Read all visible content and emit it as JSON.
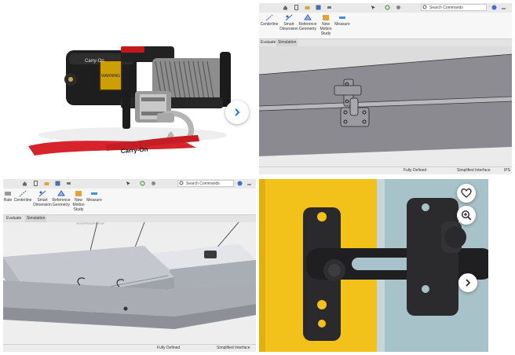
{
  "panel_product": {
    "winch_brand": "Carry-On",
    "strap_text": "Carry-On",
    "next_icon": "chevron-right-icon"
  },
  "panel_cad_top": {
    "ribbon": {
      "tool_centerline": "Centerline",
      "tool_smart_dimension": "Smart Dimension",
      "tool_reference_geometry": "Reference Geometry",
      "tool_new_motion_study": "New Motion Study",
      "tool_measure": "Measure"
    },
    "tab_evaluate": "Evaluate",
    "tab_simulation": "Simulation",
    "search_placeholder": "Search Commands",
    "status_defined": "Fully Defined",
    "status_interface": "Simplified Interface",
    "status_units": "IPS"
  },
  "panel_cad_bottom": {
    "ribbon": {
      "tool_rate": "Rate",
      "tool_centerline": "Centerline",
      "tool_smart_dimension": "Smart Dimension",
      "tool_reference_geometry": "Reference Geometry",
      "tool_new_motion_study": "New Motion Study",
      "tool_measure": "Measure"
    },
    "tab_evaluate": "Evaluate",
    "tab_simulation": "Simulation",
    "search_placeholder": "Search Commands",
    "status_defined": "Fully Defined",
    "status_interface": "Simplified Interface"
  },
  "panel_latch": {
    "icons": [
      "heart-icon",
      "zoom-in-icon",
      "chevron-right-icon"
    ]
  }
}
